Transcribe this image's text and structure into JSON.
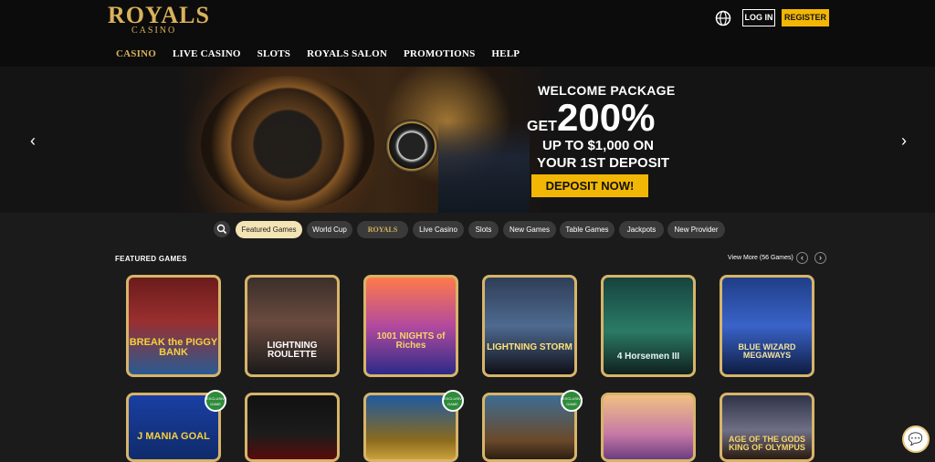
{
  "header": {
    "logo_main": "ROYALS",
    "logo_sub": "CASINO",
    "nav": [
      "CASINO",
      "LIVE CASINO",
      "SLOTS",
      "ROYALS SALON",
      "PROMOTIONS",
      "HELP"
    ],
    "active_nav": "CASINO",
    "login_label": "LOG IN",
    "register_label": "REGISTER"
  },
  "banner": {
    "title": "WELCOME PACKAGE",
    "get": "GET",
    "percent": "200%",
    "line1": "UP TO $1,000 ON",
    "line2": "YOUR 1ST DEPOSIT",
    "cta": "DEPOSIT NOW!",
    "prev_icon": "‹",
    "next_icon": "›"
  },
  "filters": [
    "Featured Games",
    "World Cup",
    "ROYALS",
    "Live Casino",
    "Slots",
    "New Games",
    "Table Games",
    "Jackpots",
    "New Provider"
  ],
  "featured": {
    "title": "FEATURED GAMES",
    "view_more": "View More (56 Games)",
    "prev": "‹",
    "next": "›"
  },
  "games_row1": [
    {
      "title": "BREAK the PIGGY BANK"
    },
    {
      "title": "LIGHTNING ROULETTE"
    },
    {
      "title": "1001 NIGHTS of Riches"
    },
    {
      "title": "LIGHTNING STORM"
    },
    {
      "title": "4 Horsemen III"
    },
    {
      "title": "BLUE WIZARD MEGAWAYS"
    }
  ],
  "games_row2": [
    {
      "title": "J MANIA GOAL",
      "badge": "EXCLUSIVE GAME"
    },
    {
      "title": "",
      "badge": ""
    },
    {
      "title": "",
      "badge": "EXCLUSIVE GAME"
    },
    {
      "title": "",
      "badge": "EXCLUSIVE GAME"
    },
    {
      "title": "",
      "badge": ""
    },
    {
      "title": "AGE OF THE GODS KING OF OLYMPUS",
      "badge": ""
    }
  ],
  "colors": {
    "gold": "#d9b25a",
    "accent_yellow": "#f2b705",
    "header_bg": "#0c0c0c",
    "page_bg": "#1b1b1b",
    "chip_active": "#f3e4b5",
    "badge_green": "#2e8b3a"
  },
  "icons": {
    "globe": "globe-icon",
    "search": "search-icon",
    "chat": "chat-icon"
  }
}
